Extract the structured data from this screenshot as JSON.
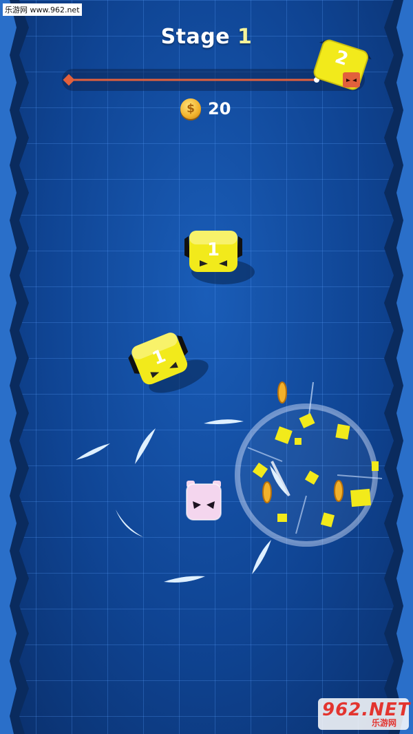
{
  "watermark": "乐游网 www.962.net",
  "hud": {
    "stage_label": "Stage",
    "stage_number": "1",
    "coin_count": "20",
    "progress": 0.9
  },
  "enemies": [
    {
      "label": "1",
      "color": "#f2ea1b"
    },
    {
      "label": "1",
      "color": "#f2ea1b"
    },
    {
      "label": "2",
      "color": "#f2ea1b"
    }
  ],
  "coin_symbol": "$",
  "logo": {
    "big": "962.NET",
    "small": "乐游网"
  },
  "colors": {
    "background": "#0f4493",
    "grid": "#5aa0ff",
    "enemy": "#f2ea1b",
    "player": "#f4d6ee",
    "progress_line": "#e2603c"
  }
}
